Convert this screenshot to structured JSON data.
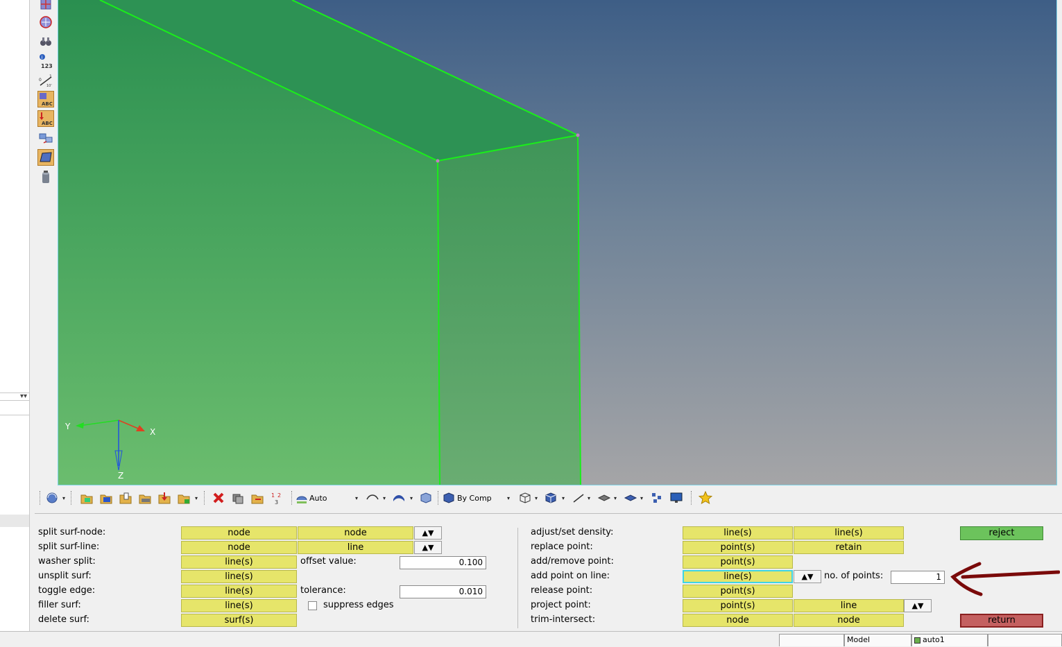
{
  "viewport": {
    "axis_labels": {
      "x": "X",
      "y": "Y",
      "z": "Z"
    },
    "colors": {
      "edge": "#1aee1a",
      "face_left": "#3d9e5c",
      "face_right": "#55a86a",
      "bg_top": "#3e5e86",
      "bg_bottom": "#a5a5a7"
    }
  },
  "left_toolbar": {
    "icons": [
      "view-icon-1",
      "view-icon-2",
      "binoculars-icon",
      "info-123-icon",
      "scale-icon",
      "abc-label-icon-1",
      "abc-label-icon-2",
      "transform-icon",
      "surface-select-icon",
      "cylinder-icon"
    ]
  },
  "toolbar": {
    "visual_mode": "Auto",
    "color_mode": "By Comp"
  },
  "panel": {
    "left": {
      "rows": [
        {
          "label": "split surf-node:",
          "btn1": "node",
          "btn2": "node"
        },
        {
          "label": "split surf-line:",
          "btn1": "node",
          "btn2": "line"
        },
        {
          "label": "washer split:",
          "btn1": "line(s)",
          "field_label": "offset value:",
          "field_value": "0.100"
        },
        {
          "label": "unsplit surf:",
          "btn1": "line(s)"
        },
        {
          "label": "toggle edge:",
          "btn1": "line(s)",
          "field_label": "tolerance:",
          "field_value": "0.010"
        },
        {
          "label": "filler surf:",
          "btn1": "line(s)",
          "check_label": "suppress edges"
        },
        {
          "label": "delete surf:",
          "btn1": "surf(s)"
        }
      ]
    },
    "right": {
      "rows": [
        {
          "label": "adjust/set density:",
          "btn1": "line(s)",
          "btn2": "line(s)"
        },
        {
          "label": "replace point:",
          "btn1": "point(s)",
          "btn2": "retain"
        },
        {
          "label": "add/remove point:",
          "btn1": "point(s)"
        },
        {
          "label": "add point on line:",
          "btn1": "line(s)",
          "field_label": "no. of points:",
          "field_value": "1"
        },
        {
          "label": "release point:",
          "btn1": "point(s)"
        },
        {
          "label": "project point:",
          "btn1": "point(s)",
          "btn2": "line"
        },
        {
          "label": "trim-intersect:",
          "btn1": "node",
          "btn2": "node"
        }
      ]
    },
    "reject_label": "reject",
    "return_label": "return"
  },
  "status": {
    "model_label": "Model",
    "component_label": "auto1"
  }
}
